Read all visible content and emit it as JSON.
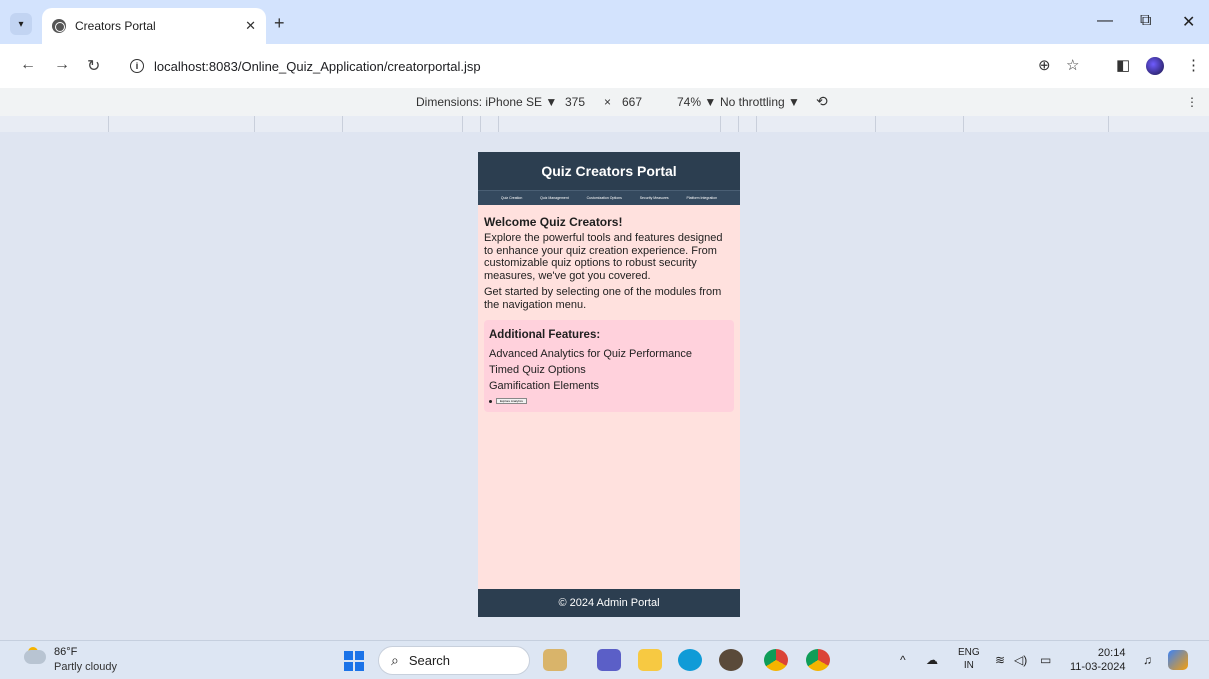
{
  "browser": {
    "tab_title": "Creators Portal",
    "tab_close": "✕",
    "new_tab": "+",
    "url": "localhost:8083/Online_Quiz_Application/creatorportal.jsp",
    "window_controls": {
      "minimize": "—",
      "restore": "⧉",
      "close": "✕"
    }
  },
  "devtools": {
    "dimensions_label": "Dimensions: iPhone SE ▼",
    "width": "375",
    "times": "×",
    "height": "667",
    "zoom": "74% ▼",
    "throttling": "No throttling ▼",
    "more": "⋮"
  },
  "page": {
    "header_title": "Quiz Creators Portal",
    "nav": [
      "Quiz Creation",
      "Quiz Management",
      "Customization Options",
      "Security Measures",
      "Platform Integration"
    ],
    "welcome_title": "Welcome Quiz Creators!",
    "intro": "Explore the powerful tools and features designed to enhance your quiz creation experience. From customizable quiz options to robust security measures, we've got you covered.",
    "get_started": "Get started by selecting one of the modules from the navigation menu.",
    "features_title": "Additional Features:",
    "features": [
      "Advanced Analytics for Quiz Performance",
      "Timed Quiz Options",
      "Gamification Elements"
    ],
    "explore_button": "Explore Analytics",
    "footer": "© 2024 Admin Portal"
  },
  "taskbar": {
    "temperature": "86°F",
    "weather": "Partly cloudy",
    "search_placeholder": "Search",
    "lang_line1": "ENG",
    "lang_line2": "IN",
    "time": "20:14",
    "date": "11-03-2024"
  },
  "colors": {
    "page_bg": "#ffe1de",
    "header_bg": "#2c3e50",
    "features_bg": "#ffd1dc"
  }
}
